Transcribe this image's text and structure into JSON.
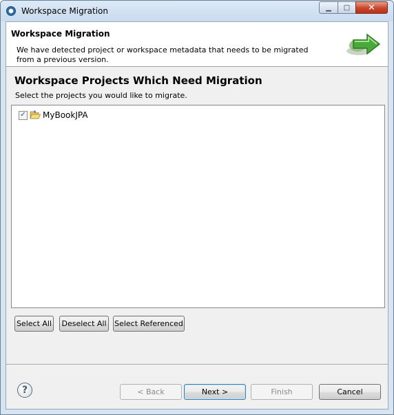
{
  "window": {
    "title": "Workspace Migration",
    "controls": {
      "minimize": "▁",
      "maximize": "□",
      "close": "✕"
    }
  },
  "banner": {
    "title": "Workspace Migration",
    "description": "We have detected project or workspace metadata that needs to be migrated from a previous version.",
    "icon": "green-arrow-icon"
  },
  "section": {
    "title": "Workspace Projects Which Need Migration",
    "description": "Select the projects you would like to migrate."
  },
  "projects": [
    {
      "label": "MyBookJPA",
      "checked": true,
      "icon": "open-folder-icon"
    }
  ],
  "selection_buttons": {
    "select_all": "Select All",
    "deselect_all": "Deselect All",
    "select_referenced": "Select Referenced"
  },
  "footer": {
    "help": "?",
    "back": "< Back",
    "next": "Next >",
    "finish": "Finish",
    "cancel": "Cancel"
  },
  "colors": {
    "accent_green": "#3c9a2a",
    "default_button_border": "#3c7fb1",
    "close_button": "#c9452c"
  }
}
